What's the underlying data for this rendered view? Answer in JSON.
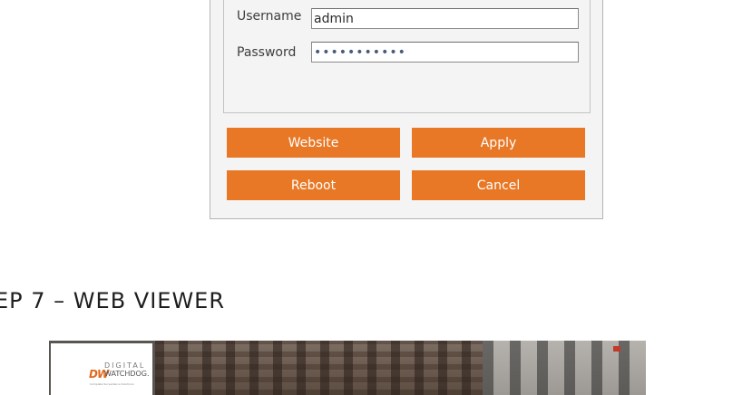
{
  "login": {
    "username_label": "Username",
    "username_value": "admin",
    "password_label": "Password",
    "password_value": "•••••••••••"
  },
  "buttons": {
    "website": "Website",
    "apply": "Apply",
    "reboot": "Reboot",
    "cancel": "Cancel"
  },
  "colors": {
    "button_bg": "#e87826",
    "dialog_bg": "#f4f4f4"
  },
  "step_heading": "EP 7 – WEB VIEWER",
  "viewer": {
    "logo_mark": "DW",
    "logo_line1": "DIGITAL",
    "logo_line2": "WATCHDOG.",
    "logo_tagline": "Complete Surveillance Solutions"
  }
}
